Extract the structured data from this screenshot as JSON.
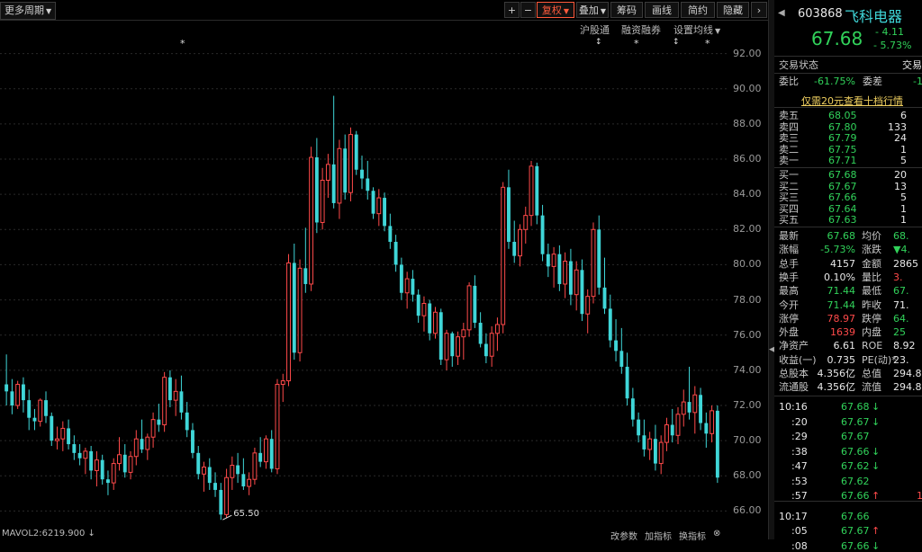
{
  "toolbar": {
    "period": "更多周期",
    "plus": "+",
    "minus": "−",
    "fq": "复权",
    "overlay": "叠加",
    "chip": "筹码",
    "draw": "画线",
    "simple": "简约",
    "hide": "隐藏"
  },
  "subbar": {
    "hgt": "沪股通",
    "margin": "融资融券",
    "ma": "设置均线"
  },
  "chart": {
    "y_ticks": [
      "92.00",
      "90.00",
      "88.00",
      "86.00",
      "84.00",
      "82.00",
      "80.00",
      "78.00",
      "76.00",
      "74.00",
      "72.00",
      "70.00",
      "68.00",
      "66.00"
    ],
    "low_label": "65.50",
    "up_color": "#ff4a4a",
    "down_color": "#3fd6d8"
  },
  "chart_data": {
    "type": "candlestick",
    "ylim": [
      65.0,
      93.0
    ],
    "low_mark": 65.5,
    "candles": [
      [
        73.2,
        74.9,
        72.0,
        72.8
      ],
      [
        72.8,
        73.5,
        71.5,
        72.0
      ],
      [
        72.0,
        73.4,
        71.8,
        73.2
      ],
      [
        73.2,
        73.6,
        71.6,
        72.3
      ],
      [
        72.3,
        72.9,
        70.6,
        71.3
      ],
      [
        71.3,
        71.8,
        70.6,
        71.1
      ],
      [
        71.1,
        72.4,
        70.8,
        72.3
      ],
      [
        72.3,
        72.8,
        71.0,
        71.4
      ],
      [
        71.4,
        71.6,
        69.7,
        70.0
      ],
      [
        70.0,
        70.8,
        69.5,
        70.1
      ],
      [
        70.1,
        71.1,
        69.4,
        70.7
      ],
      [
        70.7,
        71.2,
        69.5,
        69.8
      ],
      [
        69.8,
        70.3,
        68.9,
        69.3
      ],
      [
        69.3,
        69.8,
        68.6,
        69.0
      ],
      [
        69.0,
        69.6,
        68.1,
        69.4
      ],
      [
        69.4,
        69.7,
        67.8,
        68.3
      ],
      [
        68.3,
        69.4,
        67.4,
        68.9
      ],
      [
        68.9,
        69.2,
        67.5,
        67.8
      ],
      [
        67.8,
        68.3,
        66.9,
        67.6
      ],
      [
        67.6,
        69.0,
        67.2,
        68.7
      ],
      [
        68.7,
        70.2,
        68.3,
        69.2
      ],
      [
        69.2,
        69.8,
        67.9,
        68.2
      ],
      [
        68.2,
        69.4,
        67.8,
        69.1
      ],
      [
        69.1,
        70.6,
        68.6,
        70.1
      ],
      [
        70.1,
        71.2,
        69.3,
        69.5
      ],
      [
        69.5,
        70.4,
        68.9,
        70.2
      ],
      [
        70.2,
        71.6,
        69.6,
        71.2
      ],
      [
        71.2,
        72.1,
        70.5,
        70.9
      ],
      [
        70.9,
        73.9,
        70.5,
        73.6
      ],
      [
        73.6,
        74.0,
        71.9,
        72.3
      ],
      [
        72.3,
        73.5,
        71.4,
        72.8
      ],
      [
        72.8,
        73.7,
        71.2,
        71.6
      ],
      [
        71.6,
        72.2,
        70.2,
        70.6
      ],
      [
        70.6,
        71.0,
        69.0,
        69.3
      ],
      [
        69.3,
        69.7,
        67.8,
        68.1
      ],
      [
        68.1,
        68.8,
        67.1,
        68.5
      ],
      [
        68.5,
        69.0,
        67.2,
        67.6
      ],
      [
        67.6,
        68.2,
        66.8,
        67.2
      ],
      [
        67.2,
        67.6,
        65.5,
        65.8
      ],
      [
        65.8,
        68.4,
        65.6,
        67.9
      ],
      [
        67.9,
        69.1,
        67.2,
        68.6
      ],
      [
        68.6,
        69.3,
        67.6,
        68.1
      ],
      [
        68.1,
        69.0,
        67.2,
        67.4
      ],
      [
        67.4,
        68.2,
        66.9,
        67.8
      ],
      [
        67.8,
        69.6,
        67.5,
        69.3
      ],
      [
        69.3,
        70.2,
        68.5,
        68.8
      ],
      [
        68.8,
        70.3,
        68.4,
        70.1
      ],
      [
        70.1,
        70.6,
        68.2,
        68.4
      ],
      [
        68.4,
        73.5,
        68.1,
        73.2
      ],
      [
        73.2,
        73.8,
        72.2,
        73.4
      ],
      [
        73.4,
        80.6,
        73.1,
        80.1
      ],
      [
        80.1,
        81.2,
        74.6,
        75.0
      ],
      [
        75.0,
        80.3,
        74.5,
        79.8
      ],
      [
        79.8,
        82.1,
        78.4,
        78.9
      ],
      [
        78.9,
        86.7,
        78.5,
        86.1
      ],
      [
        86.1,
        87.2,
        81.8,
        82.4
      ],
      [
        82.4,
        85.5,
        82.0,
        84.8
      ],
      [
        84.8,
        86.3,
        83.8,
        85.7
      ],
      [
        85.7,
        89.6,
        83.2,
        83.5
      ],
      [
        83.5,
        87.1,
        82.6,
        86.6
      ],
      [
        86.6,
        87.4,
        83.7,
        84.1
      ],
      [
        84.1,
        87.8,
        83.6,
        87.4
      ],
      [
        87.4,
        87.6,
        85.1,
        85.4
      ],
      [
        85.4,
        86.2,
        84.3,
        84.9
      ],
      [
        84.9,
        85.9,
        83.7,
        84.2
      ],
      [
        84.2,
        84.4,
        82.6,
        82.9
      ],
      [
        82.9,
        84.3,
        82.2,
        83.8
      ],
      [
        83.8,
        84.1,
        81.9,
        82.2
      ],
      [
        82.2,
        82.9,
        80.9,
        81.3
      ],
      [
        81.3,
        81.7,
        79.6,
        80.0
      ],
      [
        80.0,
        80.4,
        78.0,
        78.4
      ],
      [
        78.4,
        79.6,
        77.5,
        79.2
      ],
      [
        79.2,
        79.7,
        77.9,
        78.3
      ],
      [
        78.3,
        78.6,
        76.7,
        77.1
      ],
      [
        77.1,
        78.2,
        76.2,
        77.8
      ],
      [
        77.8,
        78.0,
        75.7,
        76.1
      ],
      [
        76.1,
        77.6,
        75.8,
        77.3
      ],
      [
        77.3,
        77.5,
        74.3,
        74.6
      ],
      [
        74.6,
        76.3,
        74.0,
        76.1
      ],
      [
        76.1,
        76.2,
        74.2,
        74.8
      ],
      [
        74.8,
        76.2,
        74.3,
        75.9
      ],
      [
        75.9,
        76.7,
        74.6,
        76.3
      ],
      [
        76.3,
        79.0,
        75.9,
        78.8
      ],
      [
        78.8,
        79.4,
        76.4,
        76.7
      ],
      [
        76.7,
        77.3,
        75.3,
        75.5
      ],
      [
        75.5,
        76.1,
        74.4,
        74.8
      ],
      [
        74.8,
        76.5,
        74.2,
        76.1
      ],
      [
        76.1,
        77.0,
        75.1,
        76.6
      ],
      [
        76.6,
        84.7,
        76.1,
        84.4
      ],
      [
        84.4,
        85.4,
        80.9,
        81.3
      ],
      [
        81.3,
        82.5,
        80.1,
        80.5
      ],
      [
        80.5,
        82.3,
        79.9,
        82.0
      ],
      [
        82.0,
        83.3,
        81.2,
        82.8
      ],
      [
        82.8,
        85.9,
        82.2,
        85.6
      ],
      [
        85.6,
        85.8,
        82.3,
        82.8
      ],
      [
        82.8,
        83.4,
        80.2,
        80.6
      ],
      [
        80.6,
        81.2,
        79.3,
        79.9
      ],
      [
        79.9,
        81.0,
        78.7,
        80.6
      ],
      [
        80.6,
        81.1,
        78.5,
        78.9
      ],
      [
        78.9,
        80.7,
        78.1,
        80.2
      ],
      [
        80.2,
        80.9,
        77.7,
        78.3
      ],
      [
        78.3,
        80.2,
        77.4,
        79.7
      ],
      [
        79.7,
        80.3,
        76.8,
        77.2
      ],
      [
        77.2,
        78.6,
        76.1,
        78.2
      ],
      [
        78.2,
        82.4,
        77.8,
        82.0
      ],
      [
        82.0,
        82.8,
        78.3,
        78.7
      ],
      [
        78.7,
        80.4,
        77.2,
        77.5
      ],
      [
        77.5,
        78.3,
        75.3,
        75.7
      ],
      [
        75.7,
        76.9,
        74.5,
        75.1
      ],
      [
        75.1,
        76.4,
        73.8,
        74.2
      ],
      [
        74.2,
        75.0,
        72.0,
        72.4
      ],
      [
        72.4,
        73.0,
        70.8,
        71.2
      ],
      [
        71.2,
        71.6,
        69.9,
        70.3
      ],
      [
        70.3,
        71.2,
        69.1,
        69.5
      ],
      [
        69.5,
        70.5,
        68.9,
        70.1
      ],
      [
        70.1,
        70.9,
        68.3,
        68.7
      ],
      [
        68.7,
        70.3,
        68.1,
        69.9
      ],
      [
        69.9,
        71.3,
        69.4,
        70.9
      ],
      [
        70.9,
        71.8,
        69.9,
        70.3
      ],
      [
        70.3,
        71.9,
        69.8,
        71.5
      ],
      [
        71.5,
        72.9,
        70.8,
        72.2
      ],
      [
        72.2,
        74.2,
        71.2,
        71.6
      ],
      [
        71.6,
        73.1,
        70.4,
        72.6
      ],
      [
        72.6,
        73.0,
        70.6,
        71.0
      ],
      [
        71.0,
        71.6,
        69.6,
        70.4
      ],
      [
        70.4,
        72.0,
        69.9,
        71.7
      ],
      [
        71.7,
        72.0,
        67.6,
        67.9
      ]
    ]
  },
  "panel": {
    "code": "603868",
    "name": "飞科电器",
    "price": "67.68",
    "change": "- 4.11",
    "pct": "- 5.73%",
    "status_label": "交易状态",
    "status_value": "交易",
    "webi_label": "委比",
    "webi_value": "-61.75%",
    "weicha_label": "委差",
    "weicha_value": "-1",
    "promo": "仅需20元查看十档行情",
    "asks": [
      {
        "label": "卖五",
        "price": "68.05",
        "vol": "6"
      },
      {
        "label": "卖四",
        "price": "67.80",
        "vol": "133"
      },
      {
        "label": "卖三",
        "price": "67.79",
        "vol": "24"
      },
      {
        "label": "卖二",
        "price": "67.75",
        "vol": "1"
      },
      {
        "label": "卖一",
        "price": "67.71",
        "vol": "5"
      }
    ],
    "bids": [
      {
        "label": "买一",
        "price": "67.68",
        "vol": "20"
      },
      {
        "label": "买二",
        "price": "67.67",
        "vol": "13"
      },
      {
        "label": "买三",
        "price": "67.66",
        "vol": "5"
      },
      {
        "label": "买四",
        "price": "67.64",
        "vol": "1"
      },
      {
        "label": "买五",
        "price": "67.63",
        "vol": "1"
      }
    ],
    "stats": [
      {
        "l1": "最新",
        "v1": "67.68",
        "c1": "green",
        "l2": "均价",
        "v2": "68.",
        "c2": "green"
      },
      {
        "l1": "涨幅",
        "v1": "-5.73%",
        "c1": "green",
        "l2": "涨跌",
        "v2": "▼4.",
        "c2": "green"
      },
      {
        "l1": "总手",
        "v1": "4157",
        "c1": "white",
        "l2": "金额",
        "v2": "2865",
        "c2": "white"
      },
      {
        "l1": "换手",
        "v1": "0.10%",
        "c1": "white",
        "l2": "量比",
        "v2": "3.",
        "c2": "red"
      },
      {
        "l1": "最高",
        "v1": "71.44",
        "c1": "green",
        "l2": "最低",
        "v2": "67.",
        "c2": "green"
      },
      {
        "l1": "今开",
        "v1": "71.44",
        "c1": "green",
        "l2": "昨收",
        "v2": "71.",
        "c2": "white"
      },
      {
        "l1": "涨停",
        "v1": "78.97",
        "c1": "red",
        "l2": "跌停",
        "v2": "64.",
        "c2": "green"
      },
      {
        "l1": "外盘",
        "v1": "1639",
        "c1": "red",
        "l2": "内盘",
        "v2": "25",
        "c2": "green"
      },
      {
        "l1": "净资产",
        "v1": "6.61",
        "c1": "white",
        "l2": "ROE",
        "v2": "8.92",
        "c2": "white"
      },
      {
        "l1": "收益(一)",
        "v1": "0.735",
        "c1": "white",
        "l2": "PE(动)*",
        "v2": "23.",
        "c2": "white"
      },
      {
        "l1": "总股本",
        "v1": "4.356亿",
        "c1": "white",
        "l2": "总值",
        "v2": "294.8",
        "c2": "white"
      },
      {
        "l1": "流通股",
        "v1": "4.356亿",
        "c1": "white",
        "l2": "流值",
        "v2": "294.8",
        "c2": "white"
      }
    ],
    "ticks": [
      {
        "t": "10:16",
        "p": "67.68",
        "a": "↓",
        "ac": "green",
        "v": ""
      },
      {
        "t": ":20",
        "p": "67.67",
        "a": "↓",
        "ac": "green",
        "v": ""
      },
      {
        "t": ":29",
        "p": "67.67",
        "a": "",
        "ac": "green",
        "v": ""
      },
      {
        "t": ":38",
        "p": "67.66",
        "a": "↓",
        "ac": "green",
        "v": ""
      },
      {
        "t": ":47",
        "p": "67.62",
        "a": "↓",
        "ac": "green",
        "v": ""
      },
      {
        "t": ":53",
        "p": "67.62",
        "a": "",
        "ac": "green",
        "v": ""
      },
      {
        "t": ":57",
        "p": "67.66",
        "a": "↑",
        "ac": "red",
        "v": "1"
      },
      {
        "t": "10:17",
        "p": "67.66",
        "a": "",
        "ac": "green",
        "v": ""
      },
      {
        "t": ":05",
        "p": "67.67",
        "a": "↑",
        "ac": "red",
        "v": ""
      },
      {
        "t": ":08",
        "p": "67.66",
        "a": "↓",
        "ac": "green",
        "v": ""
      }
    ]
  },
  "bottom": {
    "vol": "MAVOL2:6219.900 ↓",
    "right1": "改参数",
    "right2": "加指标",
    "right3": "换指标"
  }
}
